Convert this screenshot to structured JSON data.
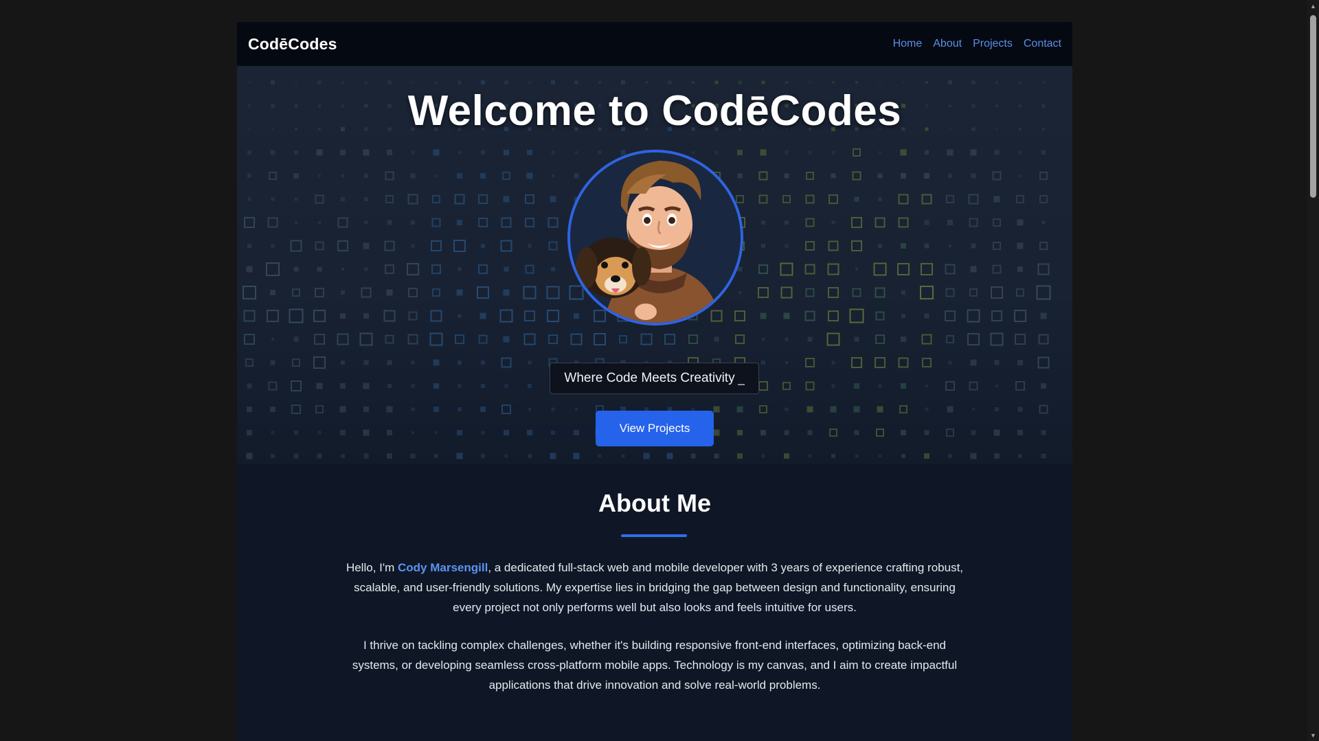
{
  "nav": {
    "brand": "CodēCodes",
    "links": [
      "Home",
      "About",
      "Projects",
      "Contact"
    ]
  },
  "hero": {
    "title": "Welcome to CodēCodes",
    "avatar_alt": "cartoon-developer-with-dog",
    "tagline": "Where Code Meets Creativity",
    "cta_label": "View Projects"
  },
  "about": {
    "title": "About Me",
    "p1_prefix": "Hello, I'm ",
    "name": "Cody Marsengill",
    "p1_suffix": ", a dedicated full-stack web and mobile developer with 3 years of experience crafting robust, scalable, and user-friendly solutions. My expertise lies in bridging the gap between design and functionality, ensuring every project not only performs well but also looks and feels intuitive for users.",
    "p2": "I thrive on tackling complex challenges, whether it's building responsive front-end interfaces, optimizing back-end systems, or developing seamless cross-platform mobile apps. Technology is my canvas, and I aim to create impactful applications that drive innovation and solve real-world problems."
  },
  "colors": {
    "accent": "#2563eb",
    "link": "#5d8eea",
    "page_bg": "#0f1726"
  },
  "icons": [
    "chevron-up-icon",
    "chevron-down-icon"
  ]
}
